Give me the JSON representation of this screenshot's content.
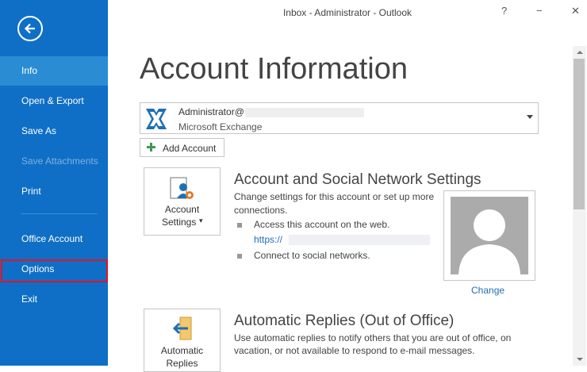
{
  "window": {
    "title": "Inbox - Administrator - Outlook",
    "help": "?",
    "minimize": "−",
    "close": "✕"
  },
  "sidebar": {
    "items": [
      {
        "label": "Info"
      },
      {
        "label": "Open & Export"
      },
      {
        "label": "Save As"
      },
      {
        "label": "Save Attachments"
      },
      {
        "label": "Print"
      },
      {
        "label": "Office Account"
      },
      {
        "label": "Options"
      },
      {
        "label": "Exit"
      }
    ]
  },
  "main": {
    "title": "Account Information",
    "account": {
      "name": "Administrator@",
      "type": "Microsoft Exchange"
    },
    "add_account": "Add Account",
    "account_settings": {
      "button_line1": "Account",
      "button_line2": "Settings",
      "button_arrow": "▾",
      "title": "Account and Social Network Settings",
      "desc_line1": "Change settings for this account or set up more",
      "desc_line2": "connections.",
      "bullet1": "Access this account on the web.",
      "link": "https://",
      "bullet2": "Connect to social networks.",
      "change": "Change"
    },
    "auto_replies": {
      "button_line1": "Automatic",
      "button_line2": "Replies",
      "title": "Automatic Replies (Out of Office)",
      "desc_line1": "Use automatic replies to notify others that you are out of office, on",
      "desc_line2": "vacation, or not available to respond to e-mail messages."
    }
  },
  "colors": {
    "sidebar": "#0f6fc6",
    "active": "#2a8dd4",
    "highlight": "#e81123",
    "link": "#1f6fb5"
  }
}
